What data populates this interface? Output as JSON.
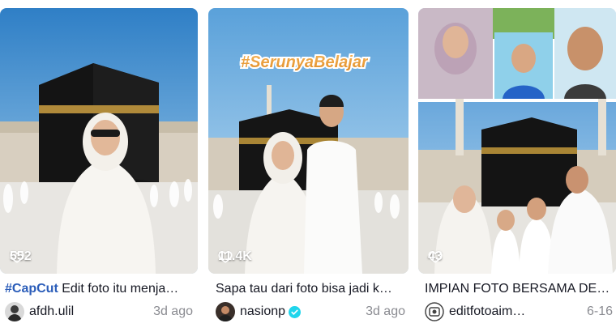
{
  "colors": {
    "hashtag": "#2b5db9",
    "date": "#8a8b91",
    "text": "#161823",
    "verified": "#20d5ec"
  },
  "cards": [
    {
      "likes": "552",
      "caption_tag": "#CapCut",
      "caption": " Edit foto itu menja…",
      "username": "afdh.ulil",
      "verified": false,
      "date": "3d ago"
    },
    {
      "likes": "11.4K",
      "overlay_text": "#SerunyaBelajar",
      "caption_tag": "",
      "caption": "Sapa tau dari foto bisa jadi k…",
      "username": "nasionp",
      "verified": true,
      "date": "3d ago"
    },
    {
      "likes": "43",
      "caption_tag": "",
      "caption": "IMPIAN FOTO BERSAMA DEP…",
      "username": "editfotoaim…",
      "verified": false,
      "date": "6-16"
    }
  ]
}
